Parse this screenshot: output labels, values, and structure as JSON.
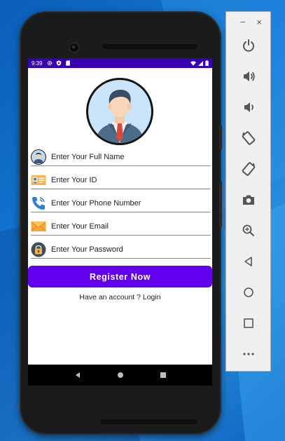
{
  "status_bar": {
    "time": "9:39"
  },
  "form": {
    "fields": [
      {
        "label": "Enter Your Full Name",
        "icon": "person-icon"
      },
      {
        "label": "Enter Your ID",
        "icon": "id-card-icon"
      },
      {
        "label": "Enter Your Phone Number",
        "icon": "phone-icon"
      },
      {
        "label": "Enter Your Email",
        "icon": "envelope-icon"
      },
      {
        "label": "Enter Your Password",
        "icon": "lock-icon"
      }
    ],
    "register_label": "Register Now",
    "login_text": "Have an account ? Login"
  },
  "colors": {
    "status_bar": "#3700b3",
    "primary": "#6200ee",
    "desktop": "#1478d4"
  },
  "emulator_panel": {
    "window_controls": [
      "−",
      "×"
    ],
    "tools": [
      "power-icon",
      "volume-up-icon",
      "volume-down-icon",
      "rotate-left-icon",
      "rotate-right-icon",
      "camera-icon",
      "zoom-icon",
      "back-icon",
      "home-icon",
      "overview-icon",
      "more-icon"
    ]
  }
}
